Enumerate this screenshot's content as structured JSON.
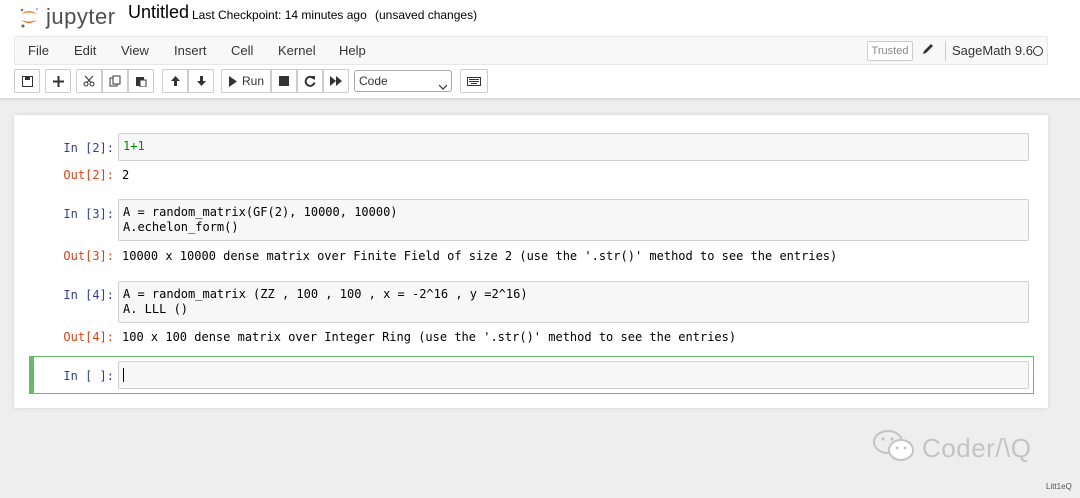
{
  "header": {
    "logo_text": "jupyter",
    "notebook_title": "Untitled",
    "checkpoint": "Last Checkpoint: 14 minutes ago",
    "autosave_status": "(unsaved changes)"
  },
  "menu": {
    "items": [
      "File",
      "Edit",
      "View",
      "Insert",
      "Cell",
      "Kernel",
      "Help"
    ],
    "trusted_label": "Trusted",
    "kernel_name": "SageMath 9.6"
  },
  "toolbar": {
    "run_label": "Run",
    "cell_type": "Code",
    "icons": [
      "save-icon",
      "plus-icon",
      "cut-icon",
      "copy-icon",
      "paste-icon",
      "arrow-up-icon",
      "arrow-down-icon",
      "play-icon",
      "stop-icon",
      "restart-icon",
      "fast-forward-icon",
      "keyboard-icon"
    ]
  },
  "cells": [
    {
      "in_prompt": "In [2]:",
      "code_lines": [
        "1+1"
      ],
      "out_prompt": "Out[2]:",
      "output": "2"
    },
    {
      "in_prompt": "In [3]:",
      "code_lines": [
        "A = random_matrix(GF(2), 10000, 10000)",
        "A.echelon_form()"
      ],
      "out_prompt": "Out[3]:",
      "output": "10000 x 10000 dense matrix over Finite Field of size 2 (use the '.str()' method to see the entries)"
    },
    {
      "in_prompt": "In [4]:",
      "code_lines": [
        "A = random_matrix (ZZ , 100 , 100 , x = -2^16 , y =2^16)",
        "A. LLL ()"
      ],
      "out_prompt": "Out[4]:",
      "output": "100 x 100 dense matrix over Integer Ring (use the '.str()' method to see the entries)"
    },
    {
      "in_prompt": "In [ ]:",
      "code_lines": [
        ""
      ]
    }
  ],
  "watermark": {
    "text": "Coder/\\Q",
    "credit": "Litt1eQ"
  },
  "colors": {
    "in_prompt": "#303f9f",
    "out_prompt": "#d84315",
    "number": "#008800",
    "operator": "#aa22ff",
    "edit_border": "#66bb6a"
  }
}
